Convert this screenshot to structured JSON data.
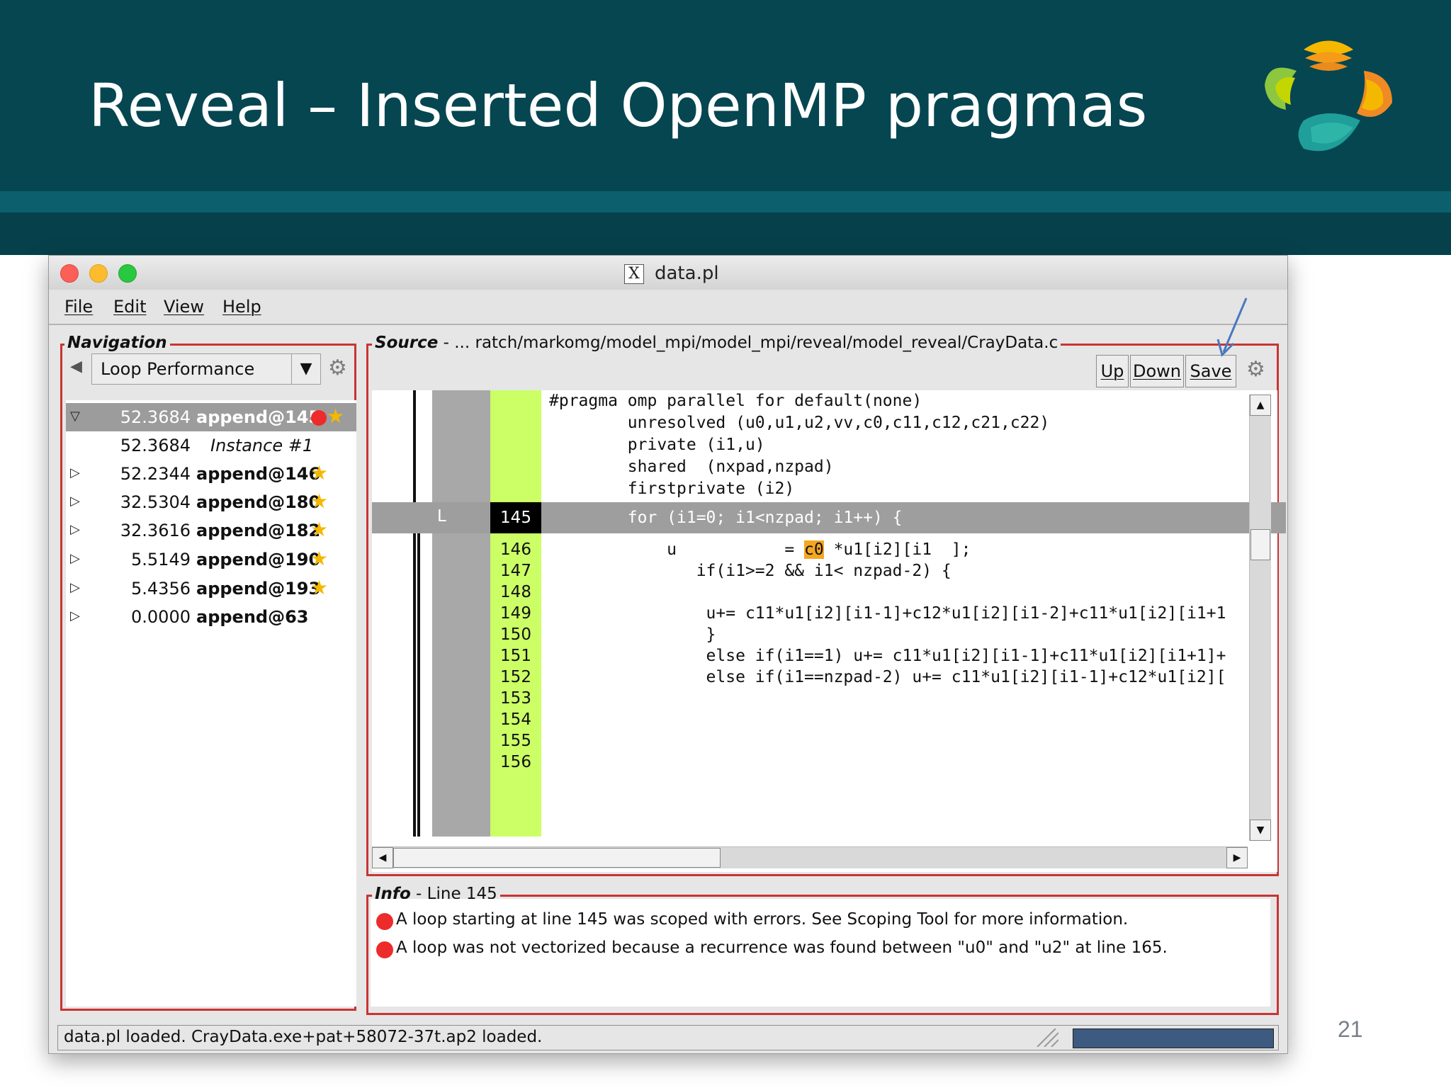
{
  "slide": {
    "title": "Reveal – Inserted OpenMP pragmas",
    "page_number": "21",
    "colors": {
      "header_bg": "#054651",
      "accent_red": "#c93434",
      "line_number_bg": "#ccff66"
    }
  },
  "window": {
    "title": "data.pl"
  },
  "menu": [
    "File",
    "Edit",
    "View",
    "Help"
  ],
  "navigation": {
    "legend": "Navigation",
    "dropdown_value": "Loop Performance",
    "items": [
      {
        "value": "52.3684",
        "name": "append@145",
        "expanded": true,
        "selected": true,
        "error": true,
        "star": true
      },
      {
        "value": "52.3684",
        "name": "Instance #1",
        "instance": true
      },
      {
        "value": "52.2344",
        "name": "append@146",
        "star": true
      },
      {
        "value": "32.5304",
        "name": "append@180",
        "star": true
      },
      {
        "value": "32.3616",
        "name": "append@182",
        "star": true
      },
      {
        "value": "5.5149",
        "name": "append@190",
        "star": true
      },
      {
        "value": "5.4356",
        "name": "append@193",
        "star": true
      },
      {
        "value": "0.0000",
        "name": "append@63"
      }
    ]
  },
  "source": {
    "legend": "Source",
    "path": " - ... ratch/markomg/model_mpi/model_mpi/reveal/model_reveal/CrayData.c",
    "buttons": {
      "up": "Up",
      "down": "Down",
      "save": "Save"
    },
    "loop_marker": "L",
    "pragma_lines": [
      "#pragma omp parallel for default(none)",
      "        unresolved (u0,u1,u2,vv,c0,c11,c12,c21,c22)",
      "        private (i1,u)",
      "        shared  (nxpad,nzpad)",
      "        firstprivate (i2)"
    ],
    "lines": [
      {
        "num": "145",
        "code": "        for (i1=0; i1<nzpad; i1++) {",
        "current": true
      },
      {
        "num": "146",
        "code_before": "            u           = ",
        "code_hl": "c0",
        "code_after": " *u1[i2][i1  ];"
      },
      {
        "num": "147",
        "code": "               if(i1>=2 && i1< nzpad-2) {"
      },
      {
        "num": "148",
        "code": ""
      },
      {
        "num": "149",
        "code": "                u+= c11*u1[i2][i1-1]+c12*u1[i2][i1-2]+c11*u1[i2][i1+1"
      },
      {
        "num": "150",
        "code": "                }"
      },
      {
        "num": "151",
        "code": "                else if(i1==1) u+= c11*u1[i2][i1-1]+c11*u1[i2][i1+1]+"
      },
      {
        "num": "152",
        "code": "                else if(i1==nzpad-2) u+= c11*u1[i2][i1-1]+c12*u1[i2]["
      },
      {
        "num": "153",
        "code": ""
      },
      {
        "num": "154",
        "code": ""
      },
      {
        "num": "155",
        "code": ""
      },
      {
        "num": "156",
        "code": ""
      }
    ]
  },
  "info": {
    "legend": "Info",
    "subtitle": " - Line 145",
    "messages": [
      "A loop starting at line 145 was scoped with errors.  See Scoping Tool for more information.",
      "A loop was not vectorized because a recurrence was found between \"u0\" and \"u2\" at line 165."
    ]
  },
  "status": {
    "text": "data.pl loaded.  CrayData.exe+pat+58072-37t.ap2 loaded."
  }
}
